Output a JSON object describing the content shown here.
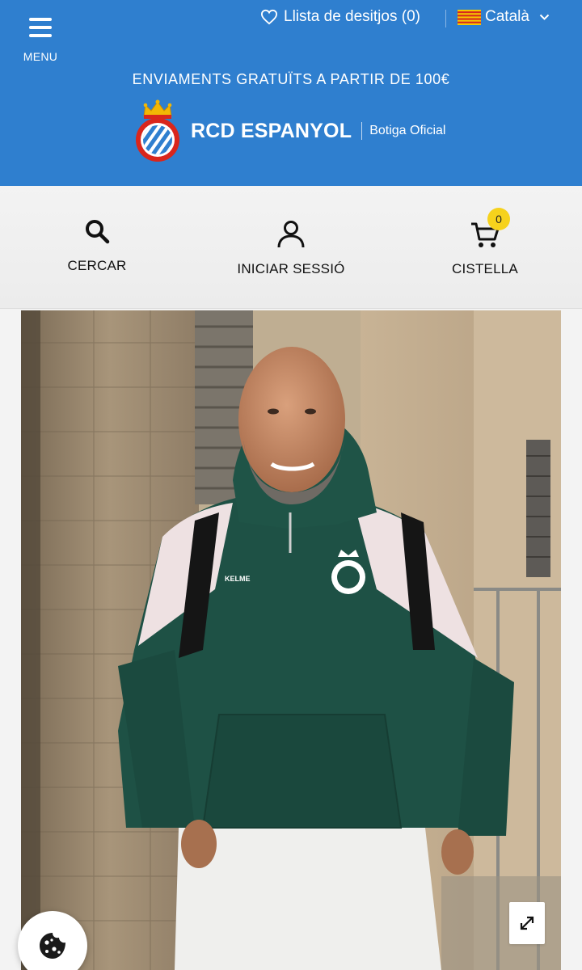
{
  "header": {
    "menu_label": "MENU",
    "wishlist_label": "Llista de desitjos (0)",
    "language_label": "Català",
    "shipping_banner": "ENVIAMENTS GRATUÏTS A PARTIR DE 100€",
    "brand_name": "RCD ESPANYOL",
    "brand_subtitle": "Botiga Oficial",
    "colors": {
      "header_bg": "#2f7fcf",
      "cart_badge": "#f6d21c"
    }
  },
  "actions": {
    "search_label": "CERCAR",
    "login_label": "INICIAR SESSIÓ",
    "cart_label": "CISTELLA",
    "cart_count": "0"
  },
  "icons": [
    "menu-icon",
    "heart-icon",
    "catalan-flag-icon",
    "chevron-down-icon",
    "club-crest-logo",
    "search-icon",
    "user-icon",
    "cart-icon",
    "expand-icon",
    "cookie-icon"
  ],
  "product_image": {
    "alt": "Product photo: man wearing a green and white RCD Espanyol hooded sweatshirt"
  }
}
